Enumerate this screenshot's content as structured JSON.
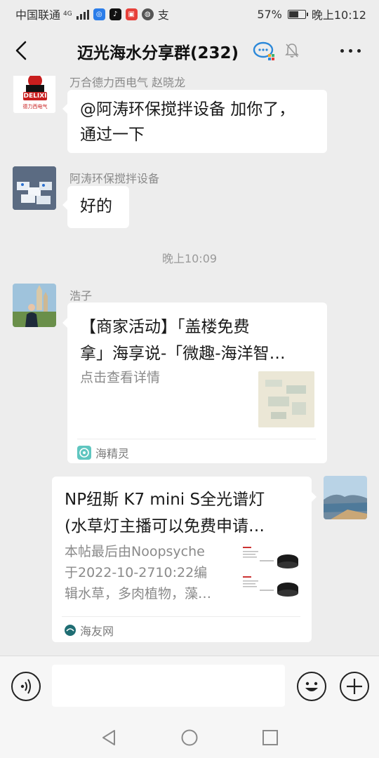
{
  "status_bar": {
    "carrier": "中国联通",
    "network": "4G",
    "battery": "57%",
    "time": "晚上10:12",
    "app_icons": [
      "wechat-work-icon",
      "tiktok-icon",
      "weibo-icon",
      "browser-icon",
      "alipay-icon"
    ],
    "pay_glyph": "支"
  },
  "header": {
    "title": "迈光海水分享群(232)",
    "back_icon": "back-chevron-icon",
    "group_icon": "wecom-group-icon",
    "mute_icon": "mute-bell-icon",
    "more_icon": "more-dots-icon"
  },
  "messages": [
    {
      "sender": "万合德力西电气 赵晓龙",
      "avatar_text": "DELIXI",
      "avatar_subtext": "德力西电气",
      "text_lines": [
        "@阿涛环保搅拌设备  加你了，",
        "通过一下"
      ]
    },
    {
      "sender": "阿涛环保搅拌设备",
      "text_lines": [
        "好的"
      ]
    },
    {
      "timestamp": "晚上10:09"
    },
    {
      "sender": "浩子",
      "card": {
        "title_lines": [
          "【商家活动】「盖楼免费",
          "拿」海享说-「微趣-海洋智…"
        ],
        "desc": "点击查看详情",
        "source": "海精灵"
      }
    },
    {
      "sender": "me",
      "card": {
        "title_lines": [
          "NP纽斯 K7 mini S全光谱灯",
          "(水草灯主播可以免费申请…"
        ],
        "desc_lines": [
          "本帖最后由Noopsyche",
          "于2022-10-2710:22编",
          "辑水草，多肉植物，藻…"
        ],
        "source": "海友网"
      }
    }
  ],
  "input": {
    "placeholder": "",
    "voice_icon": "voice-icon",
    "emoji_icon": "emoji-icon",
    "plus_icon": "plus-icon"
  },
  "system_nav": [
    "nav-back-icon",
    "nav-home-icon",
    "nav-recents-icon"
  ],
  "colors": {
    "background": "#ededed",
    "bubble": "#ffffff",
    "secondary_text": "#8a8a8a"
  }
}
